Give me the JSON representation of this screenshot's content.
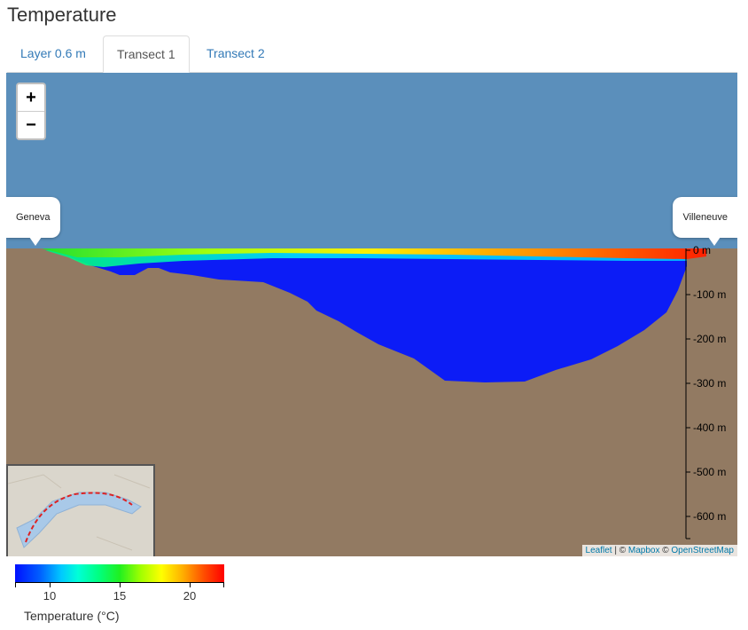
{
  "page": {
    "title": "Temperature"
  },
  "tabs": [
    {
      "label": "Layer 0.6 m",
      "active": false
    },
    {
      "label": "Transect 1",
      "active": true
    },
    {
      "label": "Transect 2",
      "active": false
    }
  ],
  "map": {
    "zoom_in": "+",
    "zoom_out": "−",
    "markers": {
      "left": "Geneva",
      "right": "Villeneuve"
    },
    "depth_axis": [
      "0 m",
      "-100 m",
      "-200 m",
      "-300 m",
      "-400 m",
      "-500 m",
      "-600 m"
    ],
    "attribution": {
      "leaflet": "Leaflet",
      "sep1": " | © ",
      "mapbox": "Mapbox",
      "sep2": " © ",
      "osm": "OpenStreetMap"
    },
    "colors": {
      "water_above": "#5b8fbb",
      "ground": "#927a62",
      "deep_water": "#0c1cf6"
    }
  },
  "legend": {
    "title": "Temperature (°C)",
    "tick_labels": [
      "10",
      "15",
      "20"
    ],
    "min": 7.5,
    "max": 22.5
  }
}
